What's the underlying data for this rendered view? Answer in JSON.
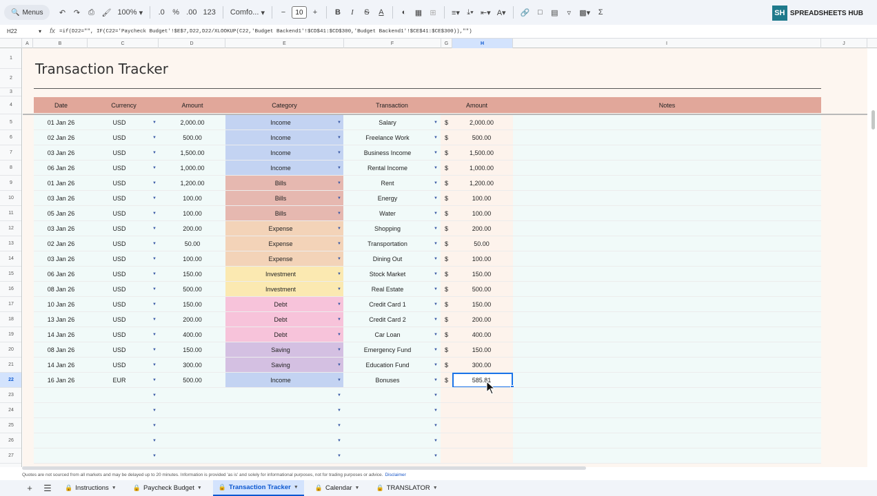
{
  "toolbar": {
    "search_label": "Menus",
    "zoom": "100%",
    "decimal_decrease": ".0",
    "percent": "%",
    "decimal_increase": ".00",
    "number_format": "123",
    "font": "Comfo...",
    "font_size": "10",
    "brand_initials": "SH",
    "brand_name": "SPREADSHEETS HUB"
  },
  "formula_bar": {
    "cell_ref": "H22",
    "formula": "=if(D22=\"\", IF(C22='Paycheck Budget'!$E$7,D22,D22/XLOOKUP(C22,'Budget Backend1'!$CD$41:$CD$300,'Budget Backend1'!$CE$41:$CE$300)),\"\")"
  },
  "columns": [
    "A",
    "B",
    "C",
    "D",
    "E",
    "F",
    "G",
    "H",
    "I",
    "J"
  ],
  "sheet": {
    "title": "Transaction Tracker",
    "headers": {
      "date": "Date",
      "currency": "Currency",
      "amount": "Amount",
      "category": "Category",
      "transaction": "Transaction",
      "amount2": "Amount",
      "notes": "Notes"
    },
    "currency_symbol": "$",
    "rows": [
      {
        "row": "5",
        "date": "01 Jan 26",
        "currency": "USD",
        "amount": "2,000.00",
        "category": "Income",
        "transaction": "Salary",
        "converted": "2,000.00"
      },
      {
        "row": "6",
        "date": "02 Jan 26",
        "currency": "USD",
        "amount": "500.00",
        "category": "Income",
        "transaction": "Freelance Work",
        "converted": "500.00"
      },
      {
        "row": "7",
        "date": "03 Jan 26",
        "currency": "USD",
        "amount": "1,500.00",
        "category": "Income",
        "transaction": "Business Income",
        "converted": "1,500.00"
      },
      {
        "row": "8",
        "date": "06 Jan 26",
        "currency": "USD",
        "amount": "1,000.00",
        "category": "Income",
        "transaction": "Rental Income",
        "converted": "1,000.00"
      },
      {
        "row": "9",
        "date": "01 Jan 26",
        "currency": "USD",
        "amount": "1,200.00",
        "category": "Bills",
        "transaction": "Rent",
        "converted": "1,200.00"
      },
      {
        "row": "10",
        "date": "03 Jan 26",
        "currency": "USD",
        "amount": "100.00",
        "category": "Bills",
        "transaction": "Energy",
        "converted": "100.00"
      },
      {
        "row": "11",
        "date": "05 Jan 26",
        "currency": "USD",
        "amount": "100.00",
        "category": "Bills",
        "transaction": "Water",
        "converted": "100.00"
      },
      {
        "row": "12",
        "date": "03 Jan 26",
        "currency": "USD",
        "amount": "200.00",
        "category": "Expense",
        "transaction": "Shopping",
        "converted": "200.00"
      },
      {
        "row": "13",
        "date": "02 Jan 26",
        "currency": "USD",
        "amount": "50.00",
        "category": "Expense",
        "transaction": "Transportation",
        "converted": "50.00"
      },
      {
        "row": "14",
        "date": "03 Jan 26",
        "currency": "USD",
        "amount": "100.00",
        "category": "Expense",
        "transaction": "Dining Out",
        "converted": "100.00"
      },
      {
        "row": "15",
        "date": "06 Jan 26",
        "currency": "USD",
        "amount": "150.00",
        "category": "Investment",
        "transaction": "Stock Market",
        "converted": "150.00"
      },
      {
        "row": "16",
        "date": "08 Jan 26",
        "currency": "USD",
        "amount": "500.00",
        "category": "Investment",
        "transaction": "Real Estate",
        "converted": "500.00"
      },
      {
        "row": "17",
        "date": "10 Jan 26",
        "currency": "USD",
        "amount": "150.00",
        "category": "Debt",
        "transaction": "Credit Card 1",
        "converted": "150.00"
      },
      {
        "row": "18",
        "date": "13 Jan 26",
        "currency": "USD",
        "amount": "200.00",
        "category": "Debt",
        "transaction": "Credit Card 2",
        "converted": "200.00"
      },
      {
        "row": "19",
        "date": "14 Jan 26",
        "currency": "USD",
        "amount": "400.00",
        "category": "Debt",
        "transaction": "Car Loan",
        "converted": "400.00"
      },
      {
        "row": "20",
        "date": "08 Jan 26",
        "currency": "USD",
        "amount": "150.00",
        "category": "Saving",
        "transaction": "Emergency Fund",
        "converted": "150.00"
      },
      {
        "row": "21",
        "date": "14 Jan 26",
        "currency": "USD",
        "amount": "300.00",
        "category": "Saving",
        "transaction": "Education Fund",
        "converted": "300.00"
      },
      {
        "row": "22",
        "date": "16 Jan 26",
        "currency": "EUR",
        "amount": "500.00",
        "category": "Income",
        "transaction": "Bonuses",
        "converted": "585.81"
      }
    ],
    "empty_rows": [
      "23",
      "24",
      "25",
      "26",
      "27"
    ],
    "category_colors": {
      "Income": "#c3d3f2",
      "Bills": "#e6b8b0",
      "Expense": "#f3d3b8",
      "Investment": "#fbe9b1",
      "Debt": "#f7c3da",
      "Saving": "#d4c0e2"
    },
    "selected_cell": "H22"
  },
  "footer": {
    "disclaimer": "Quotes are not sourced from all markets and may be delayed up to 20 minutes. Information is provided 'as is' and solely for informational purposes, not for trading purposes or advice.",
    "disclaimer_link": "Disclaimer",
    "tabs": [
      {
        "label": "Instructions",
        "locked": true,
        "active": false
      },
      {
        "label": "Paycheck Budget",
        "locked": true,
        "active": false
      },
      {
        "label": "Transaction Tracker",
        "locked": true,
        "active": true
      },
      {
        "label": "Calendar",
        "locked": true,
        "active": false
      },
      {
        "label": "TRANSLATOR",
        "locked": true,
        "active": false
      }
    ]
  }
}
